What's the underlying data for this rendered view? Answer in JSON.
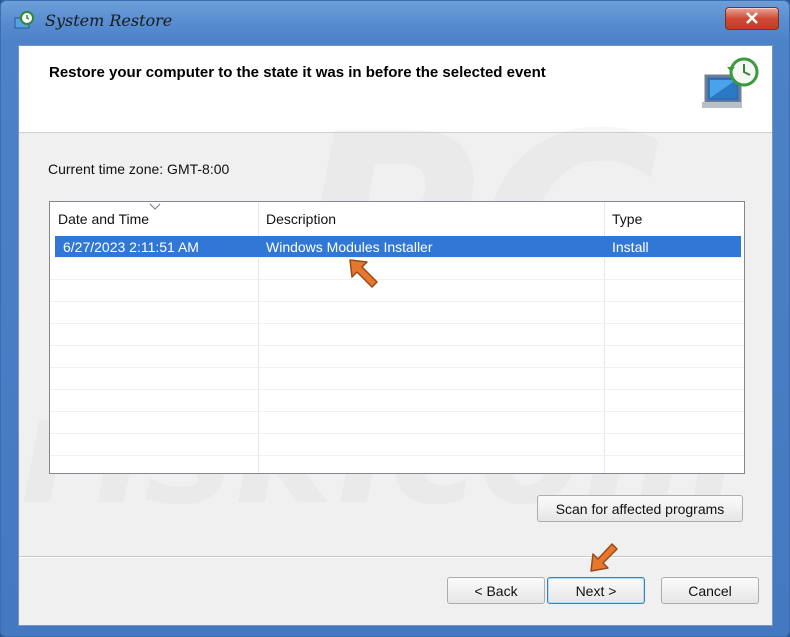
{
  "window": {
    "title": "System Restore"
  },
  "header": {
    "title": "Restore your computer to the state it was in before the selected event"
  },
  "timezone_label": "Current time zone: GMT-8:00",
  "table": {
    "columns": [
      "Date and Time",
      "Description",
      "Type"
    ],
    "rows": [
      {
        "date": "6/27/2023 2:11:51 AM",
        "description": "Windows Modules Installer",
        "type": "Install",
        "selected": true
      }
    ]
  },
  "buttons": {
    "scan": "Scan for affected programs",
    "back": "< Back",
    "next": "Next >",
    "cancel": "Cancel"
  },
  "watermark": {
    "line1": "PC",
    "line2": "risk.com"
  },
  "colors": {
    "selection": "#3178d6",
    "annotation_arrow": "#e8772e"
  }
}
